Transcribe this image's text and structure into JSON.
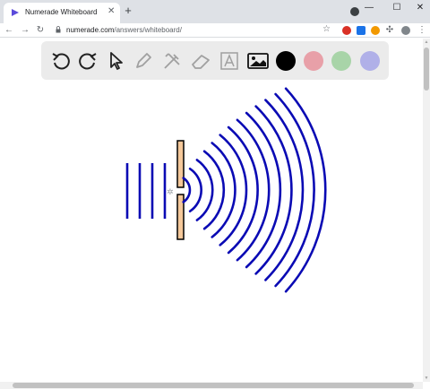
{
  "browser": {
    "tab_title": "Numerade Whiteboard",
    "tab_close": "✕",
    "new_tab": "+",
    "profile_badge": "●",
    "minimize": "—",
    "maximize": "☐",
    "close": "✕",
    "url_host": "numerade.com",
    "url_path": "/answers/whiteboard/",
    "menu": "⋮"
  },
  "whiteboard": {
    "tools": [
      "undo-icon",
      "redo-icon",
      "pointer-icon",
      "pencil-icon",
      "tools-icon",
      "eraser-icon",
      "text-icon",
      "image-icon"
    ],
    "palette": [
      "#000000",
      "#e8a0a8",
      "#a8d4a8",
      "#b0b0e8"
    ],
    "stroke_color": "#0a0ab4",
    "barrier_color": "#f5c89a"
  }
}
